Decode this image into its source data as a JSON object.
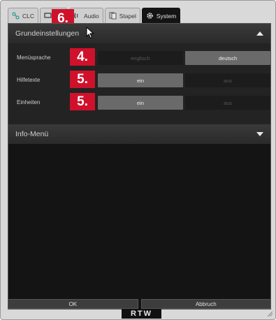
{
  "tabs": [
    {
      "label": "CLC",
      "icon": "clc-icon"
    },
    {
      "label": "",
      "icon": "monitor-icon"
    },
    {
      "label": "Audio",
      "icon": "audio-icon"
    },
    {
      "label": "Stapel",
      "icon": "stack-icon"
    },
    {
      "label": "System",
      "icon": "gear-icon",
      "active": true
    }
  ],
  "badges": {
    "tab": "6.",
    "language": "4.",
    "help": "5.",
    "units": "5."
  },
  "basic_settings": {
    "title": "Grundeinstellungen",
    "expanded": true,
    "rows": [
      {
        "label": "Menüsprache",
        "option_a": "englisch",
        "option_b": "deutsch",
        "selected": "deutsch"
      },
      {
        "label": "Hilfetexte",
        "option_a": "ein",
        "option_b": "aus",
        "selected": "ein"
      },
      {
        "label": "Einheiten",
        "option_a": "ein",
        "option_b": "aus",
        "selected": "ein"
      }
    ]
  },
  "info_menu": {
    "title": "Info-Menü",
    "expanded": false
  },
  "footer": {
    "ok_label": "OK",
    "cancel_label": "Abbruch"
  },
  "logo_text": "RTW",
  "colors": {
    "badge": "#d0112b",
    "selected_option": "#6a6a6a",
    "panel_bg": "#141414"
  }
}
